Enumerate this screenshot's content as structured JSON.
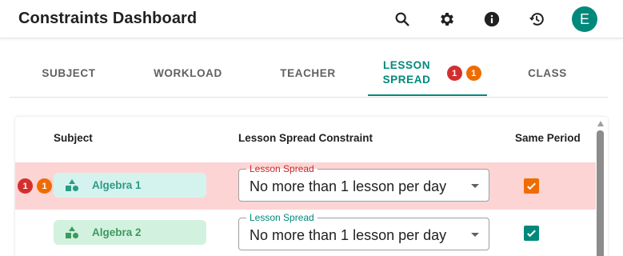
{
  "header": {
    "title": "Constraints Dashboard",
    "icons": [
      "search-icon",
      "gear-icon",
      "info-icon",
      "history-icon"
    ],
    "avatar_initial": "E"
  },
  "tabs": [
    {
      "label": "SUBJECT"
    },
    {
      "label": "WORKLOAD"
    },
    {
      "label": "TEACHER"
    },
    {
      "label_line1": "LESSON",
      "label_line2": "SPREAD",
      "active": true,
      "badges": [
        "1",
        "1"
      ]
    },
    {
      "label": "CLASS"
    }
  ],
  "table": {
    "columns": [
      "Subject",
      "Lesson Spread Constraint",
      "Same Period"
    ],
    "rows": [
      {
        "badges": [
          "1",
          "1"
        ],
        "subject": "Algebra 1",
        "spread_label": "Lesson Spread",
        "spread_value": "No more than 1 lesson per day",
        "same_period": true,
        "has_error": true
      },
      {
        "subject": "Algebra 2",
        "spread_label": "Lesson Spread",
        "spread_value": "No more than 1 lesson per day",
        "same_period": true,
        "has_error": false
      }
    ]
  },
  "colors": {
    "accent": "#00897b",
    "error_badge": "#d32f2f",
    "warning_badge": "#ef6c00",
    "error_row": "#fdd4d4",
    "chip_teal": "#d5f3ee",
    "chip_green": "#d3f1df"
  }
}
